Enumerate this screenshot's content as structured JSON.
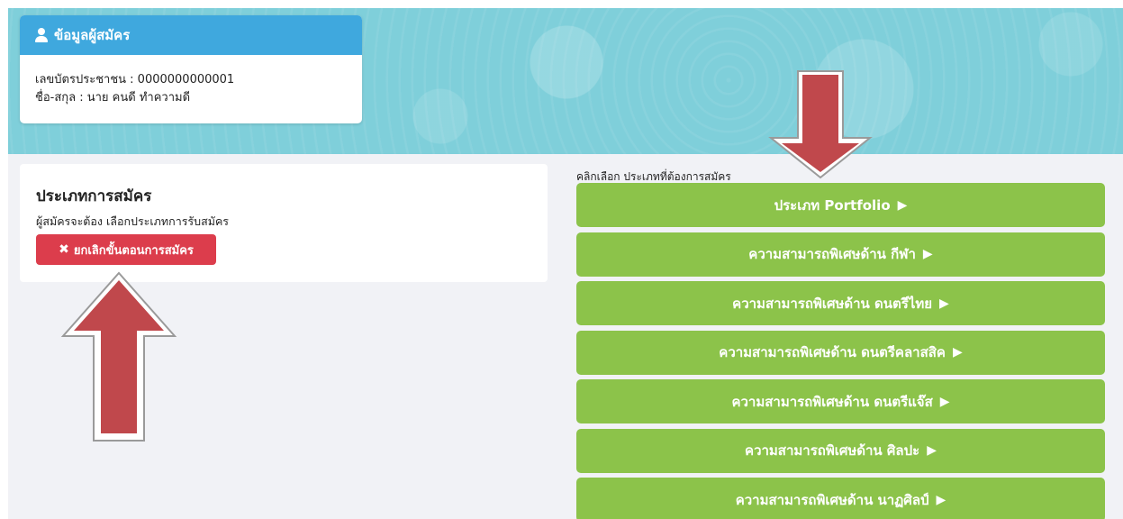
{
  "profile": {
    "header": "ข้อมูลผู้สมัคร",
    "icon": "user-icon",
    "id_line": "เลขบัตรประชาชน : 0000000000001",
    "name_line": "ชื่อ-สกุล : นาย คนดี ทำความดี"
  },
  "application": {
    "title": "ประเภทการสมัคร",
    "subtitle": "ผู้สมัครจะต้อง เลือกประเภทการรับสมัคร",
    "cancel_label": "ยกเลิกขั้นตอนการสมัคร",
    "cancel_icon": "x-icon"
  },
  "choose_label": "คลิกเลือก ประเภทที่ต้องการสมัคร",
  "options": [
    {
      "label": "ประเภท Portfolio"
    },
    {
      "label": "ความสามารถพิเศษด้าน กีฬา"
    },
    {
      "label": "ความสามารถพิเศษด้าน ดนตรีไทย"
    },
    {
      "label": "ความสามารถพิเศษด้าน ดนตรีคลาสสิค"
    },
    {
      "label": "ความสามารถพิเศษด้าน ดนตรีแจ๊ส"
    },
    {
      "label": "ความสามารถพิเศษด้าน ศิลปะ"
    },
    {
      "label": "ความสามารถพิเศษด้าน นาฏศิลป์"
    }
  ],
  "option_arrow_glyph": "▶",
  "colors": {
    "banner": "#7fcfda",
    "header_blue": "#3fa8de",
    "cancel_red": "#dc3d4c",
    "option_green": "#8cc34a",
    "annotation_arrow": "#c0484c"
  }
}
